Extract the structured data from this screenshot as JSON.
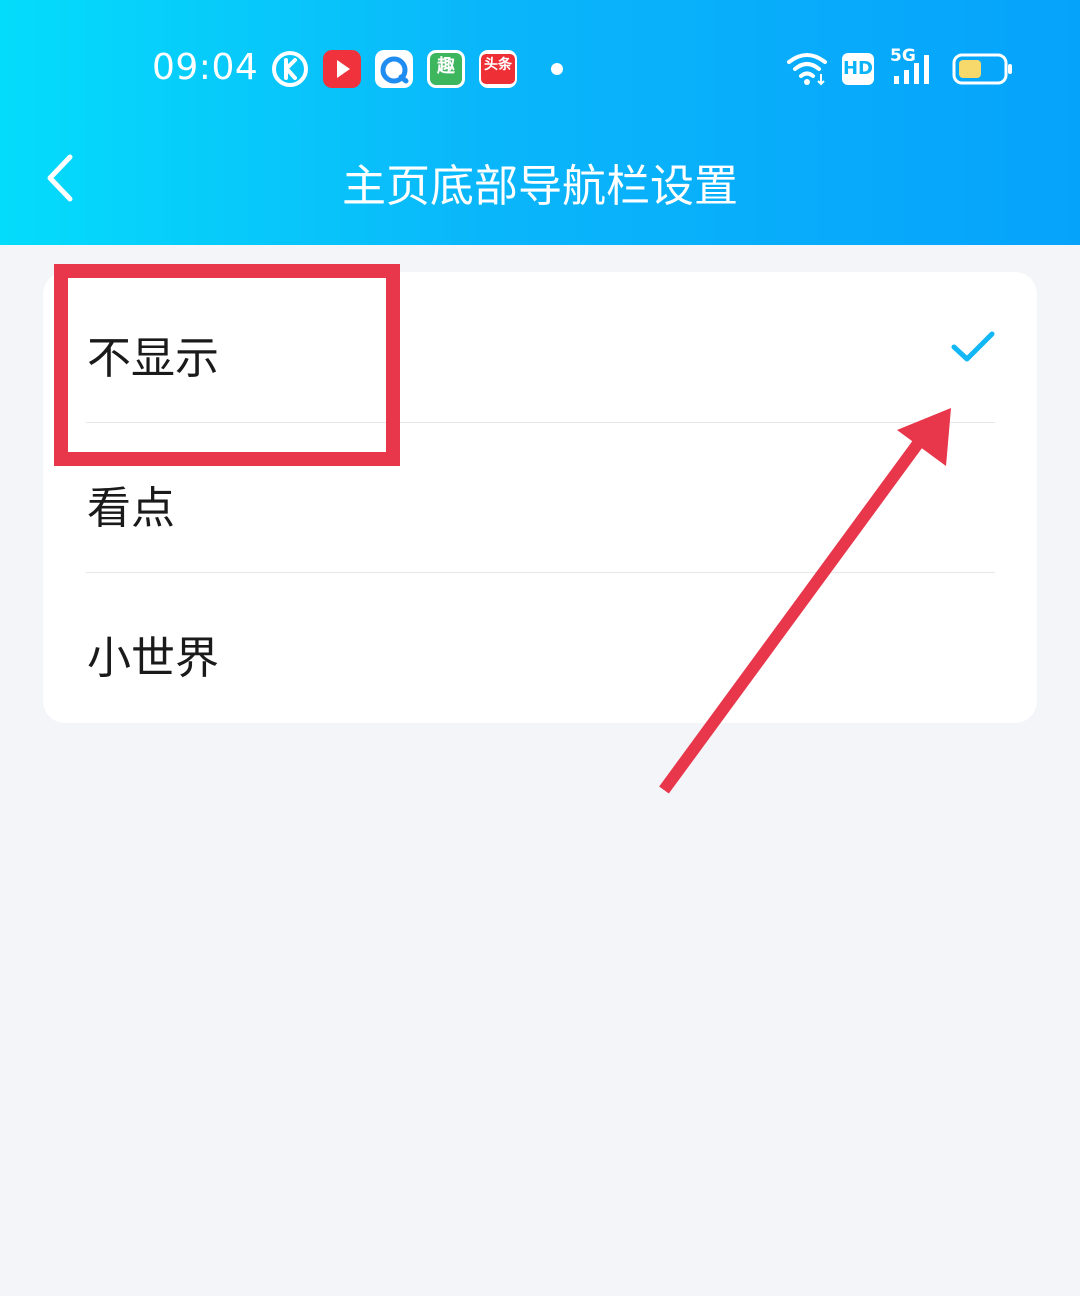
{
  "status_bar": {
    "time": "09:04",
    "app_icons": [
      "k-song-icon",
      "video-play-icon",
      "browser-icon",
      "qutoutiao-icon",
      "toutiao-icon"
    ],
    "qu_label": "趣",
    "toutiao_label": "头条",
    "hd_label": "HD",
    "network_label": "5G"
  },
  "nav": {
    "title": "主页底部导航栏设置",
    "back_icon": "chevron-left-icon"
  },
  "options": [
    {
      "label": "不显示",
      "selected": true
    },
    {
      "label": "看点",
      "selected": false
    },
    {
      "label": "小世界",
      "selected": false
    }
  ],
  "colors": {
    "header_gradient_start": "#04DCFB",
    "header_gradient_end": "#06A3FB",
    "check": "#12B7F5",
    "annotation": "#E8364B",
    "background": "#F4F5F9"
  }
}
